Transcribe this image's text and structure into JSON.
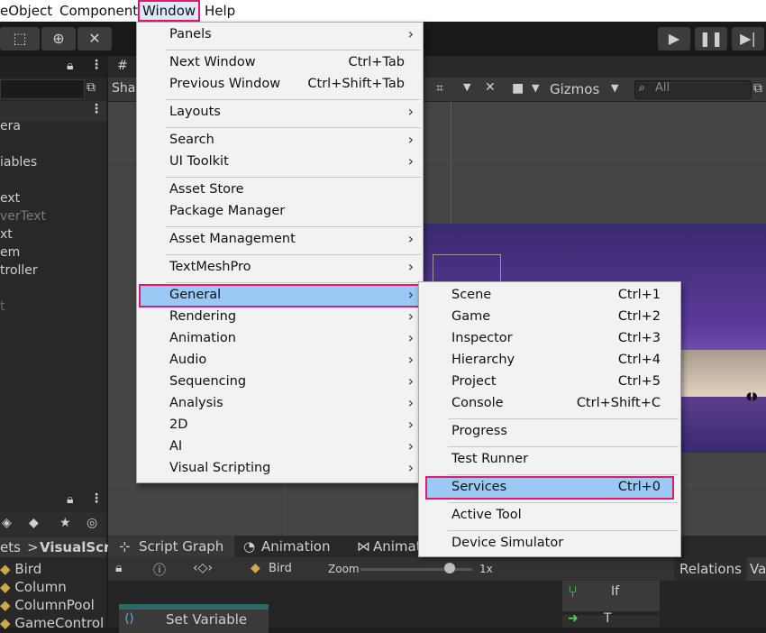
{
  "menubar": {
    "items": [
      "eObject",
      "Component",
      "Window",
      "Help"
    ]
  },
  "hierarchy": {
    "items": [
      "era",
      "",
      "iables",
      "",
      "ext",
      "verText",
      "xt",
      "em",
      "troller",
      "",
      "t"
    ]
  },
  "scene_view": {
    "shading_label": "Sha",
    "gizmos_label": "Gizmos",
    "search_placeholder": "All"
  },
  "project": {
    "path_prefix": "ets",
    "path_sep": ">",
    "path_current": "VisualScri",
    "items": [
      "Bird",
      "Column",
      "ColumnPool",
      "GameControl"
    ]
  },
  "graph": {
    "tabs": [
      "Script Graph",
      "Animation",
      "Animat"
    ],
    "object_label": "Bird",
    "zoom_label": "Zoom",
    "zoom_value": "1x",
    "zoom_fraction": 0.8,
    "relations_label": "Relations",
    "va_label": "Va",
    "node_set_variable": "Set Variable",
    "node_if": "If",
    "node_partial": "T"
  },
  "window_menu": {
    "items": [
      {
        "label": "Panels",
        "submenu": true
      },
      {
        "sep": true
      },
      {
        "label": "Next Window",
        "shortcut": "Ctrl+Tab"
      },
      {
        "label": "Previous Window",
        "shortcut": "Ctrl+Shift+Tab"
      },
      {
        "sep": true
      },
      {
        "label": "Layouts",
        "submenu": true
      },
      {
        "sep": true
      },
      {
        "label": "Search",
        "submenu": true
      },
      {
        "label": "UI Toolkit",
        "submenu": true
      },
      {
        "sep": true
      },
      {
        "label": "Asset Store"
      },
      {
        "label": "Package Manager"
      },
      {
        "sep": true
      },
      {
        "label": "Asset Management",
        "submenu": true
      },
      {
        "sep": true
      },
      {
        "label": "TextMeshPro",
        "submenu": true
      },
      {
        "sep": true
      },
      {
        "label": "General",
        "submenu": true,
        "highlighted": true
      },
      {
        "label": "Rendering",
        "submenu": true
      },
      {
        "label": "Animation",
        "submenu": true
      },
      {
        "label": "Audio",
        "submenu": true
      },
      {
        "label": "Sequencing",
        "submenu": true
      },
      {
        "label": "Analysis",
        "submenu": true
      },
      {
        "label": "2D",
        "submenu": true
      },
      {
        "label": "AI",
        "submenu": true
      },
      {
        "label": "Visual Scripting",
        "submenu": true
      }
    ]
  },
  "general_submenu": {
    "items": [
      {
        "label": "Scene",
        "shortcut": "Ctrl+1"
      },
      {
        "label": "Game",
        "shortcut": "Ctrl+2"
      },
      {
        "label": "Inspector",
        "shortcut": "Ctrl+3"
      },
      {
        "label": "Hierarchy",
        "shortcut": "Ctrl+4"
      },
      {
        "label": "Project",
        "shortcut": "Ctrl+5"
      },
      {
        "label": "Console",
        "shortcut": "Ctrl+Shift+C"
      },
      {
        "sep": true
      },
      {
        "label": "Progress"
      },
      {
        "sep": true
      },
      {
        "label": "Test Runner"
      },
      {
        "sep": true
      },
      {
        "label": "Services",
        "shortcut": "Ctrl+0",
        "highlighted": true
      },
      {
        "sep": true
      },
      {
        "label": "Active Tool"
      },
      {
        "sep": true
      },
      {
        "label": "Device Simulator"
      }
    ]
  },
  "colors": {
    "highlight": "#99c9f4",
    "annotation": "#e5196b",
    "menu_bg": "#f2f2f2",
    "editor_dark": "#282828"
  }
}
